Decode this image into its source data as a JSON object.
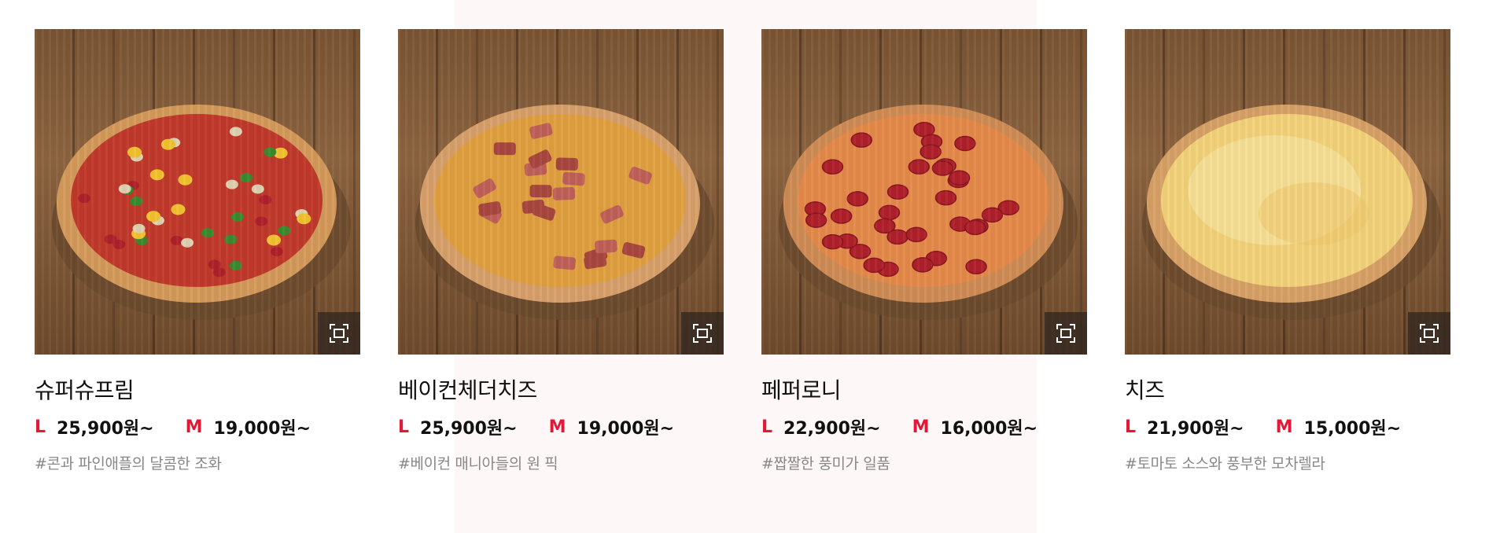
{
  "colors": {
    "accent": "#e31837",
    "title": "#111111",
    "tag": "#888888",
    "wood": "#7a5534",
    "zoom_bg": "#2d231e"
  },
  "products": [
    {
      "name": "슈퍼슈프림",
      "size_l": "L",
      "price_l": "25,900원~",
      "size_m": "M",
      "price_m": "19,000원~",
      "tag": "#콘과 파인애플의 달콤한 조화",
      "image": "pizza-super-supreme",
      "zoom_icon": "expand-icon"
    },
    {
      "name": "베이컨체더치즈",
      "size_l": "L",
      "price_l": "25,900원~",
      "size_m": "M",
      "price_m": "19,000원~",
      "tag": "#베이컨 매니아들의 원 픽",
      "image": "pizza-bacon-cheddar",
      "zoom_icon": "expand-icon"
    },
    {
      "name": "페퍼로니",
      "size_l": "L",
      "price_l": "22,900원~",
      "size_m": "M",
      "price_m": "16,000원~",
      "tag": "#짭짤한 풍미가 일품",
      "image": "pizza-pepperoni",
      "zoom_icon": "expand-icon"
    },
    {
      "name": "치즈",
      "size_l": "L",
      "price_l": "21,900원~",
      "size_m": "M",
      "price_m": "15,000원~",
      "tag": "#토마토 소스와 풍부한 모차렐라",
      "image": "pizza-cheese",
      "zoom_icon": "expand-icon"
    }
  ]
}
